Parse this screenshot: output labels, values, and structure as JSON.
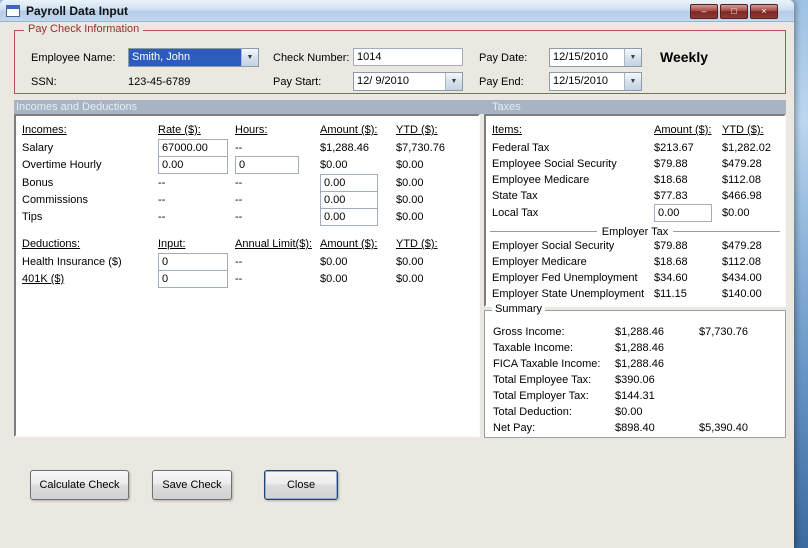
{
  "icons": {
    "dropdown": "▼",
    "minimize": "–",
    "maximize": "□",
    "close": "×"
  },
  "window": {
    "title": "Payroll Data Input"
  },
  "colors": {
    "selection_blue": "#2e5cbe",
    "group_border_red": "#b35454",
    "section_band": "#a6b4c4",
    "title_gradient": "#cfe0f2"
  },
  "paycheck": {
    "group_label": "Pay Check Information",
    "employee_name_label": "Employee Name:",
    "employee_name_value": "Smith, John",
    "ssn_label": "SSN:",
    "ssn_value": "123-45-6789",
    "check_number_label": "Check Number:",
    "check_number_value": "1014",
    "pay_start_label": "Pay Start:",
    "pay_start_value": "12/ 9/2010",
    "pay_date_label": "Pay Date:",
    "pay_date_value": "12/15/2010",
    "pay_end_label": "Pay End:",
    "pay_end_value": "12/15/2010",
    "frequency": "Weekly"
  },
  "sections": {
    "incomes": "Incomes and Deductions",
    "taxes": "Taxes"
  },
  "incomes": {
    "headers": {
      "col1": "Incomes:",
      "col2": "Rate ($):",
      "col3": "Hours:",
      "col4": "Amount ($):",
      "col5": "YTD ($):"
    },
    "rows": [
      {
        "label": "Salary",
        "rate": "67000.00",
        "hours": "--",
        "amount": "$1,288.46",
        "ytd": "$7,730.76"
      },
      {
        "label": "Overtime Hourly",
        "rate": "0.00",
        "hours": "0",
        "amount": "$0.00",
        "ytd": "$0.00"
      },
      {
        "label": "Bonus",
        "rate": "--",
        "hours": "--",
        "amount": "0.00",
        "ytd": "$0.00"
      },
      {
        "label": "Commissions",
        "rate": "--",
        "hours": "--",
        "amount": "0.00",
        "ytd": "$0.00"
      },
      {
        "label": "Tips",
        "rate": "--",
        "hours": "--",
        "amount": "0.00",
        "ytd": "$0.00"
      }
    ]
  },
  "deductions": {
    "headers": {
      "col1": "Deductions:",
      "col2": "Input:",
      "col3": "Annual Limit($):",
      "col4": "Amount ($):",
      "col5": "YTD ($):"
    },
    "rows": [
      {
        "label": "Health Insurance  ($)",
        "input": "0",
        "limit": "--",
        "amount": "$0.00",
        "ytd": "$0.00"
      },
      {
        "label": "401K  ($)",
        "input": "0",
        "limit": "--",
        "amount": "$0.00",
        "ytd": "$0.00"
      }
    ]
  },
  "taxes": {
    "headers": {
      "col1": "Items:",
      "col2": "Amount ($):",
      "col3": "YTD ($):"
    },
    "employee_rows": [
      {
        "label": "Federal Tax",
        "amount": "$213.67",
        "ytd": "$1,282.02"
      },
      {
        "label": "Employee Social Security",
        "amount": "$79.88",
        "ytd": "$479.28"
      },
      {
        "label": "Employee Medicare",
        "amount": "$18.68",
        "ytd": "$112.08"
      },
      {
        "label": "State Tax",
        "amount": "$77.83",
        "ytd": "$466.98"
      },
      {
        "label": "Local Tax",
        "amount": "0.00",
        "ytd": "$0.00"
      }
    ],
    "separator": "Employer Tax",
    "employer_rows": [
      {
        "label": "Employer Social Security",
        "amount": "$79.88",
        "ytd": "$479.28"
      },
      {
        "label": "Employer Medicare",
        "amount": "$18.68",
        "ytd": "$112.08"
      },
      {
        "label": "Employer Fed Unemployment",
        "amount": "$34.60",
        "ytd": "$434.00"
      },
      {
        "label": "Employer State Unemployment",
        "amount": "$11.15",
        "ytd": "$140.00"
      }
    ]
  },
  "summary": {
    "group_label": "Summary",
    "rows": [
      {
        "label": "Gross Income:",
        "amount": "$1,288.46",
        "ytd": "$7,730.76"
      },
      {
        "label": "Taxable Income:",
        "amount": "$1,288.46",
        "ytd": ""
      },
      {
        "label": "FICA Taxable Income:",
        "amount": "$1,288.46",
        "ytd": ""
      },
      {
        "label": "Total Employee Tax:",
        "amount": "$390.06",
        "ytd": ""
      },
      {
        "label": "Total Employer Tax:",
        "amount": "$144.31",
        "ytd": ""
      },
      {
        "label": "Total Deduction:",
        "amount": "$0.00",
        "ytd": ""
      },
      {
        "label": "Net Pay:",
        "amount": "$898.40",
        "ytd": "$5,390.40"
      }
    ]
  },
  "buttons": {
    "calculate": "Calculate Check",
    "save": "Save Check",
    "close": "Close"
  }
}
